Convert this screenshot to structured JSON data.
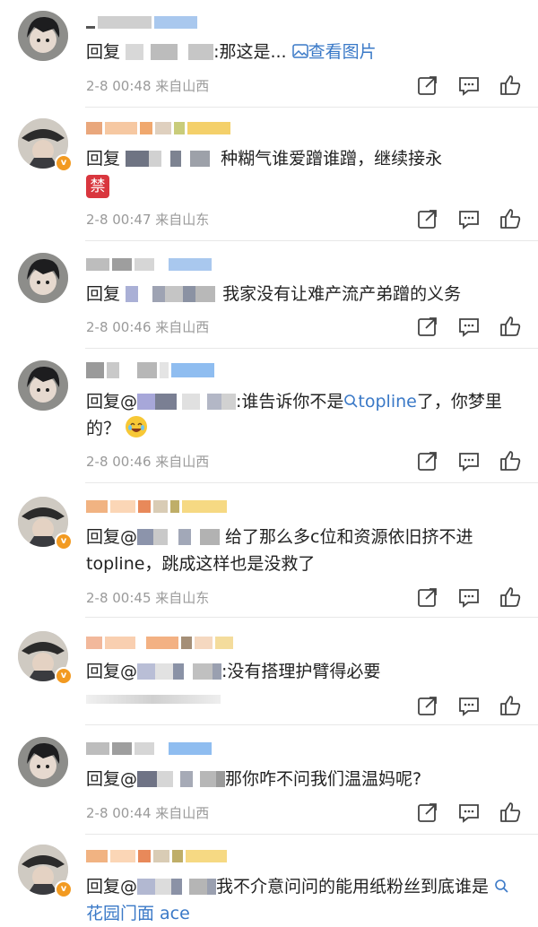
{
  "feed": {
    "comments": [
      {
        "text_prefix": "回复",
        "text_suffix": ":那这是...",
        "link_text": "查看图片",
        "time": "2-8 00:48",
        "location": "来自山西"
      },
      {
        "text_prefix": "回复",
        "text_suffix": "种糊气谁爱蹭谁蹭，继续接永",
        "badge_text": "禁",
        "time": "2-8 00:47",
        "location": "来自山东"
      },
      {
        "text_prefix": "回复",
        "text_suffix": "我家没有让难产流产弟蹭的义务",
        "time": "2-8 00:46",
        "location": "来自山西"
      },
      {
        "text_prefix": "回复@",
        "text_suffix": ":谁告诉你不是",
        "link_text": "topline",
        "text_after_link": "了，你梦里的？",
        "time": "2-8 00:46",
        "location": "来自山西"
      },
      {
        "text_prefix": "回复@",
        "text_suffix": "给了那么多c位和资源依旧挤不进topline，跳成这样也是没救了",
        "time": "2-8 00:45",
        "location": "来自山东"
      },
      {
        "text_prefix": "回复@",
        "text_suffix": ":没有搭理护臂得必要",
        "time": "",
        "location": ""
      },
      {
        "text_prefix": "回复@",
        "text_suffix": "那你咋不问我们温温妈呢?",
        "time": "2-8 00:44",
        "location": "来自山西"
      },
      {
        "text_prefix": "回复@",
        "text_suffix": "我不介意问问的能用纸粉丝到底谁是",
        "link_text": "花园门面 ace",
        "time": "",
        "location": ""
      }
    ],
    "icons": [
      "share-icon",
      "comment-icon",
      "like-icon",
      "search-link-icon",
      "image-icon"
    ],
    "colors": {
      "link": "#3a79c7",
      "meta": "#9a9a9a",
      "badge": "#f29a21"
    }
  }
}
